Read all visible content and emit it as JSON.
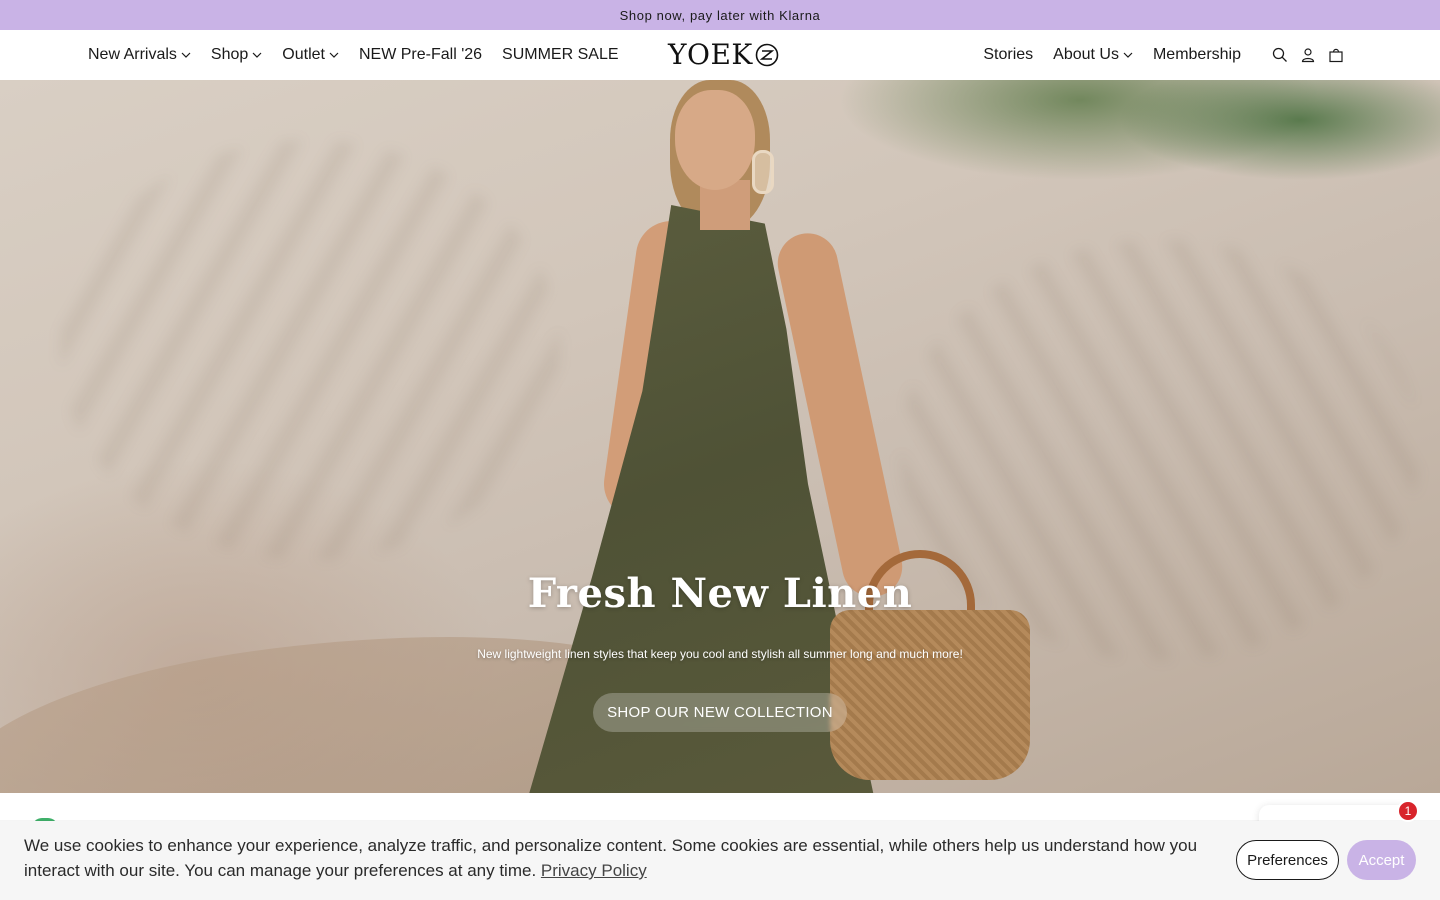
{
  "promo": {
    "text": "Shop now, pay later with Klarna"
  },
  "header": {
    "logo_text": "YOEK",
    "nav_left": [
      {
        "label": "New Arrivals",
        "has_dropdown": true
      },
      {
        "label": "Shop",
        "has_dropdown": true
      },
      {
        "label": "Outlet",
        "has_dropdown": true
      },
      {
        "label": "NEW Pre-Fall '26",
        "has_dropdown": false
      },
      {
        "label": "SUMMER SALE",
        "has_dropdown": false
      }
    ],
    "nav_right": [
      {
        "label": "Stories",
        "has_dropdown": false
      },
      {
        "label": "About Us",
        "has_dropdown": true
      },
      {
        "label": "Membership",
        "has_dropdown": false
      }
    ],
    "icons": [
      "search-icon",
      "account-icon",
      "cart-icon"
    ]
  },
  "hero": {
    "title": "Fresh New Linen",
    "subtitle": "New lightweight linen styles that keep you cool and stylish all summer long and much more!",
    "cta_label": "SHOP OUR NEW COLLECTION"
  },
  "chat": {
    "badge_count": "1"
  },
  "cookie": {
    "text": "We use cookies to enhance your experience, analyze traffic, and personalize content. Some cookies are essential, while others help us understand how you interact with our site. You can manage your preferences at any time.",
    "link_label": "Privacy Policy",
    "preferences_label": "Preferences",
    "accept_label": "Accept"
  },
  "colors": {
    "accent": "#c9b3e6",
    "badge": "#d8242b",
    "chat_green": "#3fb06a"
  }
}
